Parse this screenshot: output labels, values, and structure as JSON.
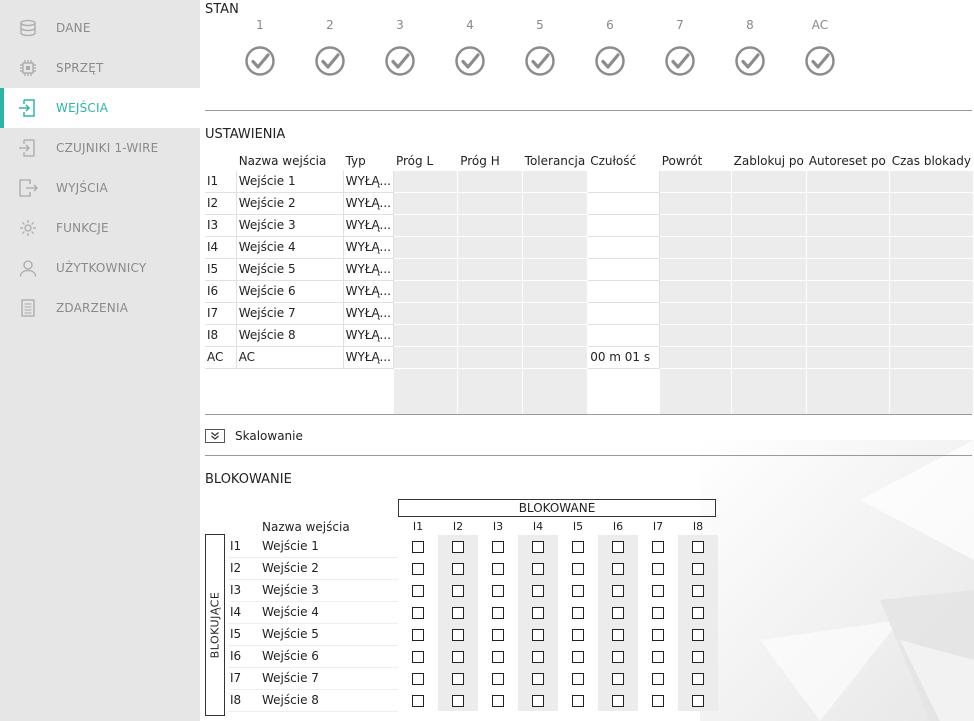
{
  "sidebar": {
    "items": [
      {
        "label": "DANE",
        "icon": "database-icon"
      },
      {
        "label": "SPRZĘT",
        "icon": "chip-icon"
      },
      {
        "label": "WEJŚCIA",
        "icon": "input-icon",
        "active": true
      },
      {
        "label": "CZUJNIKI 1-WIRE",
        "icon": "sensor-icon"
      },
      {
        "label": "WYJŚCIA",
        "icon": "output-icon"
      },
      {
        "label": "FUNKCJE",
        "icon": "gear-icon"
      },
      {
        "label": "UŻYTKOWNICY",
        "icon": "user-icon"
      },
      {
        "label": "ZDARZENIA",
        "icon": "list-icon"
      }
    ],
    "accent": "#2bb5a6"
  },
  "stan": {
    "title": "STAN",
    "columns": [
      "1",
      "2",
      "3",
      "4",
      "5",
      "6",
      "7",
      "8",
      "AC"
    ]
  },
  "ustawienia": {
    "title": "USTAWIENIA",
    "headers": [
      "",
      "Nazwa wejścia",
      "Typ",
      "Próg L",
      "Próg H",
      "Tolerancja",
      "Czułość",
      "Powrót",
      "Zablokuj po",
      "Autoreset po",
      "Czas blokady"
    ],
    "rows": [
      {
        "id": "I1",
        "name": "Wejście 1",
        "type": "WYŁĄ...",
        "czulosc": ""
      },
      {
        "id": "I2",
        "name": "Wejście 2",
        "type": "WYŁĄ...",
        "czulosc": ""
      },
      {
        "id": "I3",
        "name": "Wejście 3",
        "type": "WYŁĄ...",
        "czulosc": ""
      },
      {
        "id": "I4",
        "name": "Wejście 4",
        "type": "WYŁĄ...",
        "czulosc": ""
      },
      {
        "id": "I5",
        "name": "Wejście 5",
        "type": "WYŁĄ...",
        "czulosc": ""
      },
      {
        "id": "I6",
        "name": "Wejście 6",
        "type": "WYŁĄ...",
        "czulosc": ""
      },
      {
        "id": "I7",
        "name": "Wejście 7",
        "type": "WYŁĄ...",
        "czulosc": ""
      },
      {
        "id": "I8",
        "name": "Wejście 8",
        "type": "WYŁĄ...",
        "czulosc": ""
      },
      {
        "id": "AC",
        "name": "AC",
        "type": "WYŁĄ...",
        "czulosc": "00 m 01 s"
      }
    ]
  },
  "skalowanie": {
    "label": "Skalowanie"
  },
  "blokowanie": {
    "title": "BLOKOWANIE",
    "blokowane_label": "BLOKOWANE",
    "blokujace_label": "BLOKUJĄCE",
    "name_header": "Nazwa wejścia",
    "columns": [
      "I1",
      "I2",
      "I3",
      "I4",
      "I5",
      "I6",
      "I7",
      "I8"
    ],
    "rows": [
      {
        "id": "I1",
        "name": "Wejście 1"
      },
      {
        "id": "I2",
        "name": "Wejście 2"
      },
      {
        "id": "I3",
        "name": "Wejście 3"
      },
      {
        "id": "I4",
        "name": "Wejście 4"
      },
      {
        "id": "I5",
        "name": "Wejście 5"
      },
      {
        "id": "I6",
        "name": "Wejście 6"
      },
      {
        "id": "I7",
        "name": "Wejście 7"
      },
      {
        "id": "I8",
        "name": "Wejście 8"
      }
    ]
  }
}
